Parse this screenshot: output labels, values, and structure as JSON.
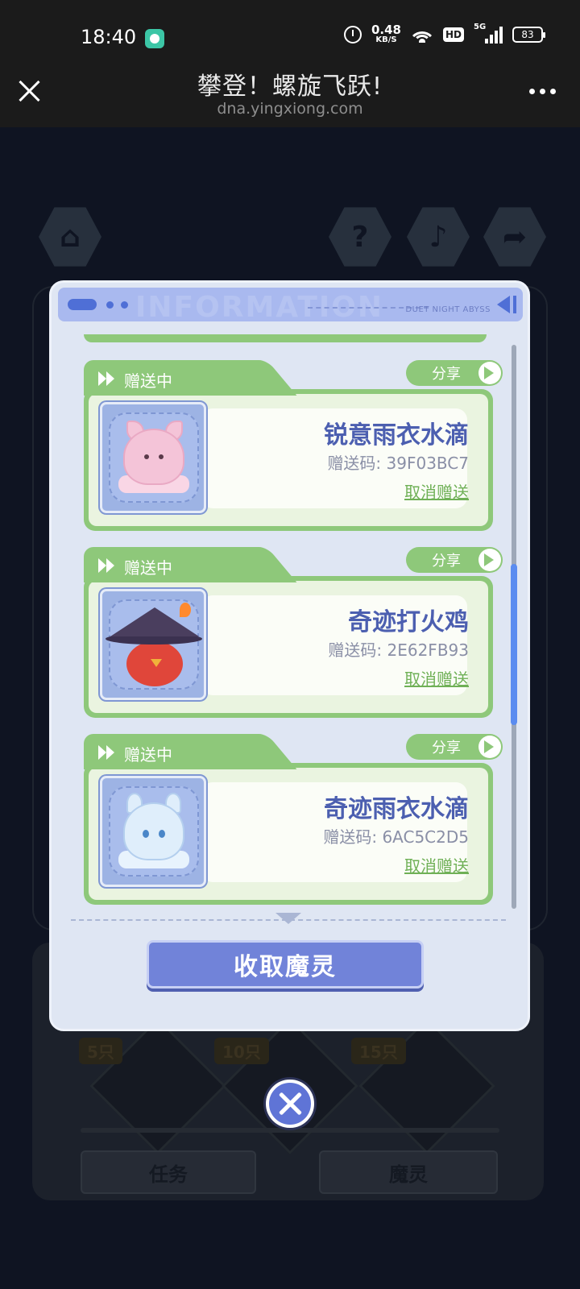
{
  "status_bar": {
    "time": "18:40",
    "net_speed_value": "0.48",
    "net_speed_unit": "KB/S",
    "hd_label": "HD",
    "network": "5G",
    "battery": "83"
  },
  "browser": {
    "title": "攀登！螺旋飞跃!",
    "url": "dna.yingxiong.com"
  },
  "background": {
    "tiers": [
      "5只",
      "10只",
      "15只"
    ],
    "buttons": [
      "任务",
      "魔灵"
    ],
    "icons": [
      "home-icon",
      "help-icon",
      "music-icon",
      "share-icon"
    ]
  },
  "modal": {
    "header_watermark": "INFORMATION",
    "header_brand": "DUET NIGHT ABYSS",
    "cards": [
      {
        "status": "赠送中",
        "share_label": "分享",
        "name": "锐意雨衣水滴",
        "code": "赠送码: 39F03BC7",
        "cancel_label": "取消赠送"
      },
      {
        "status": "赠送中",
        "share_label": "分享",
        "name": "奇迹打火鸡",
        "code": "赠送码: 2E62FB93",
        "cancel_label": "取消赠送"
      },
      {
        "status": "赠送中",
        "share_label": "分享",
        "name": "奇迹雨衣水滴",
        "code": "赠送码: 6AC5C2D5",
        "cancel_label": "取消赠送"
      }
    ],
    "collect_button": "收取魔灵"
  },
  "colors": {
    "accent": "#7183d9",
    "card_green": "#8ec87a",
    "name_blue": "#4c5fb0"
  }
}
